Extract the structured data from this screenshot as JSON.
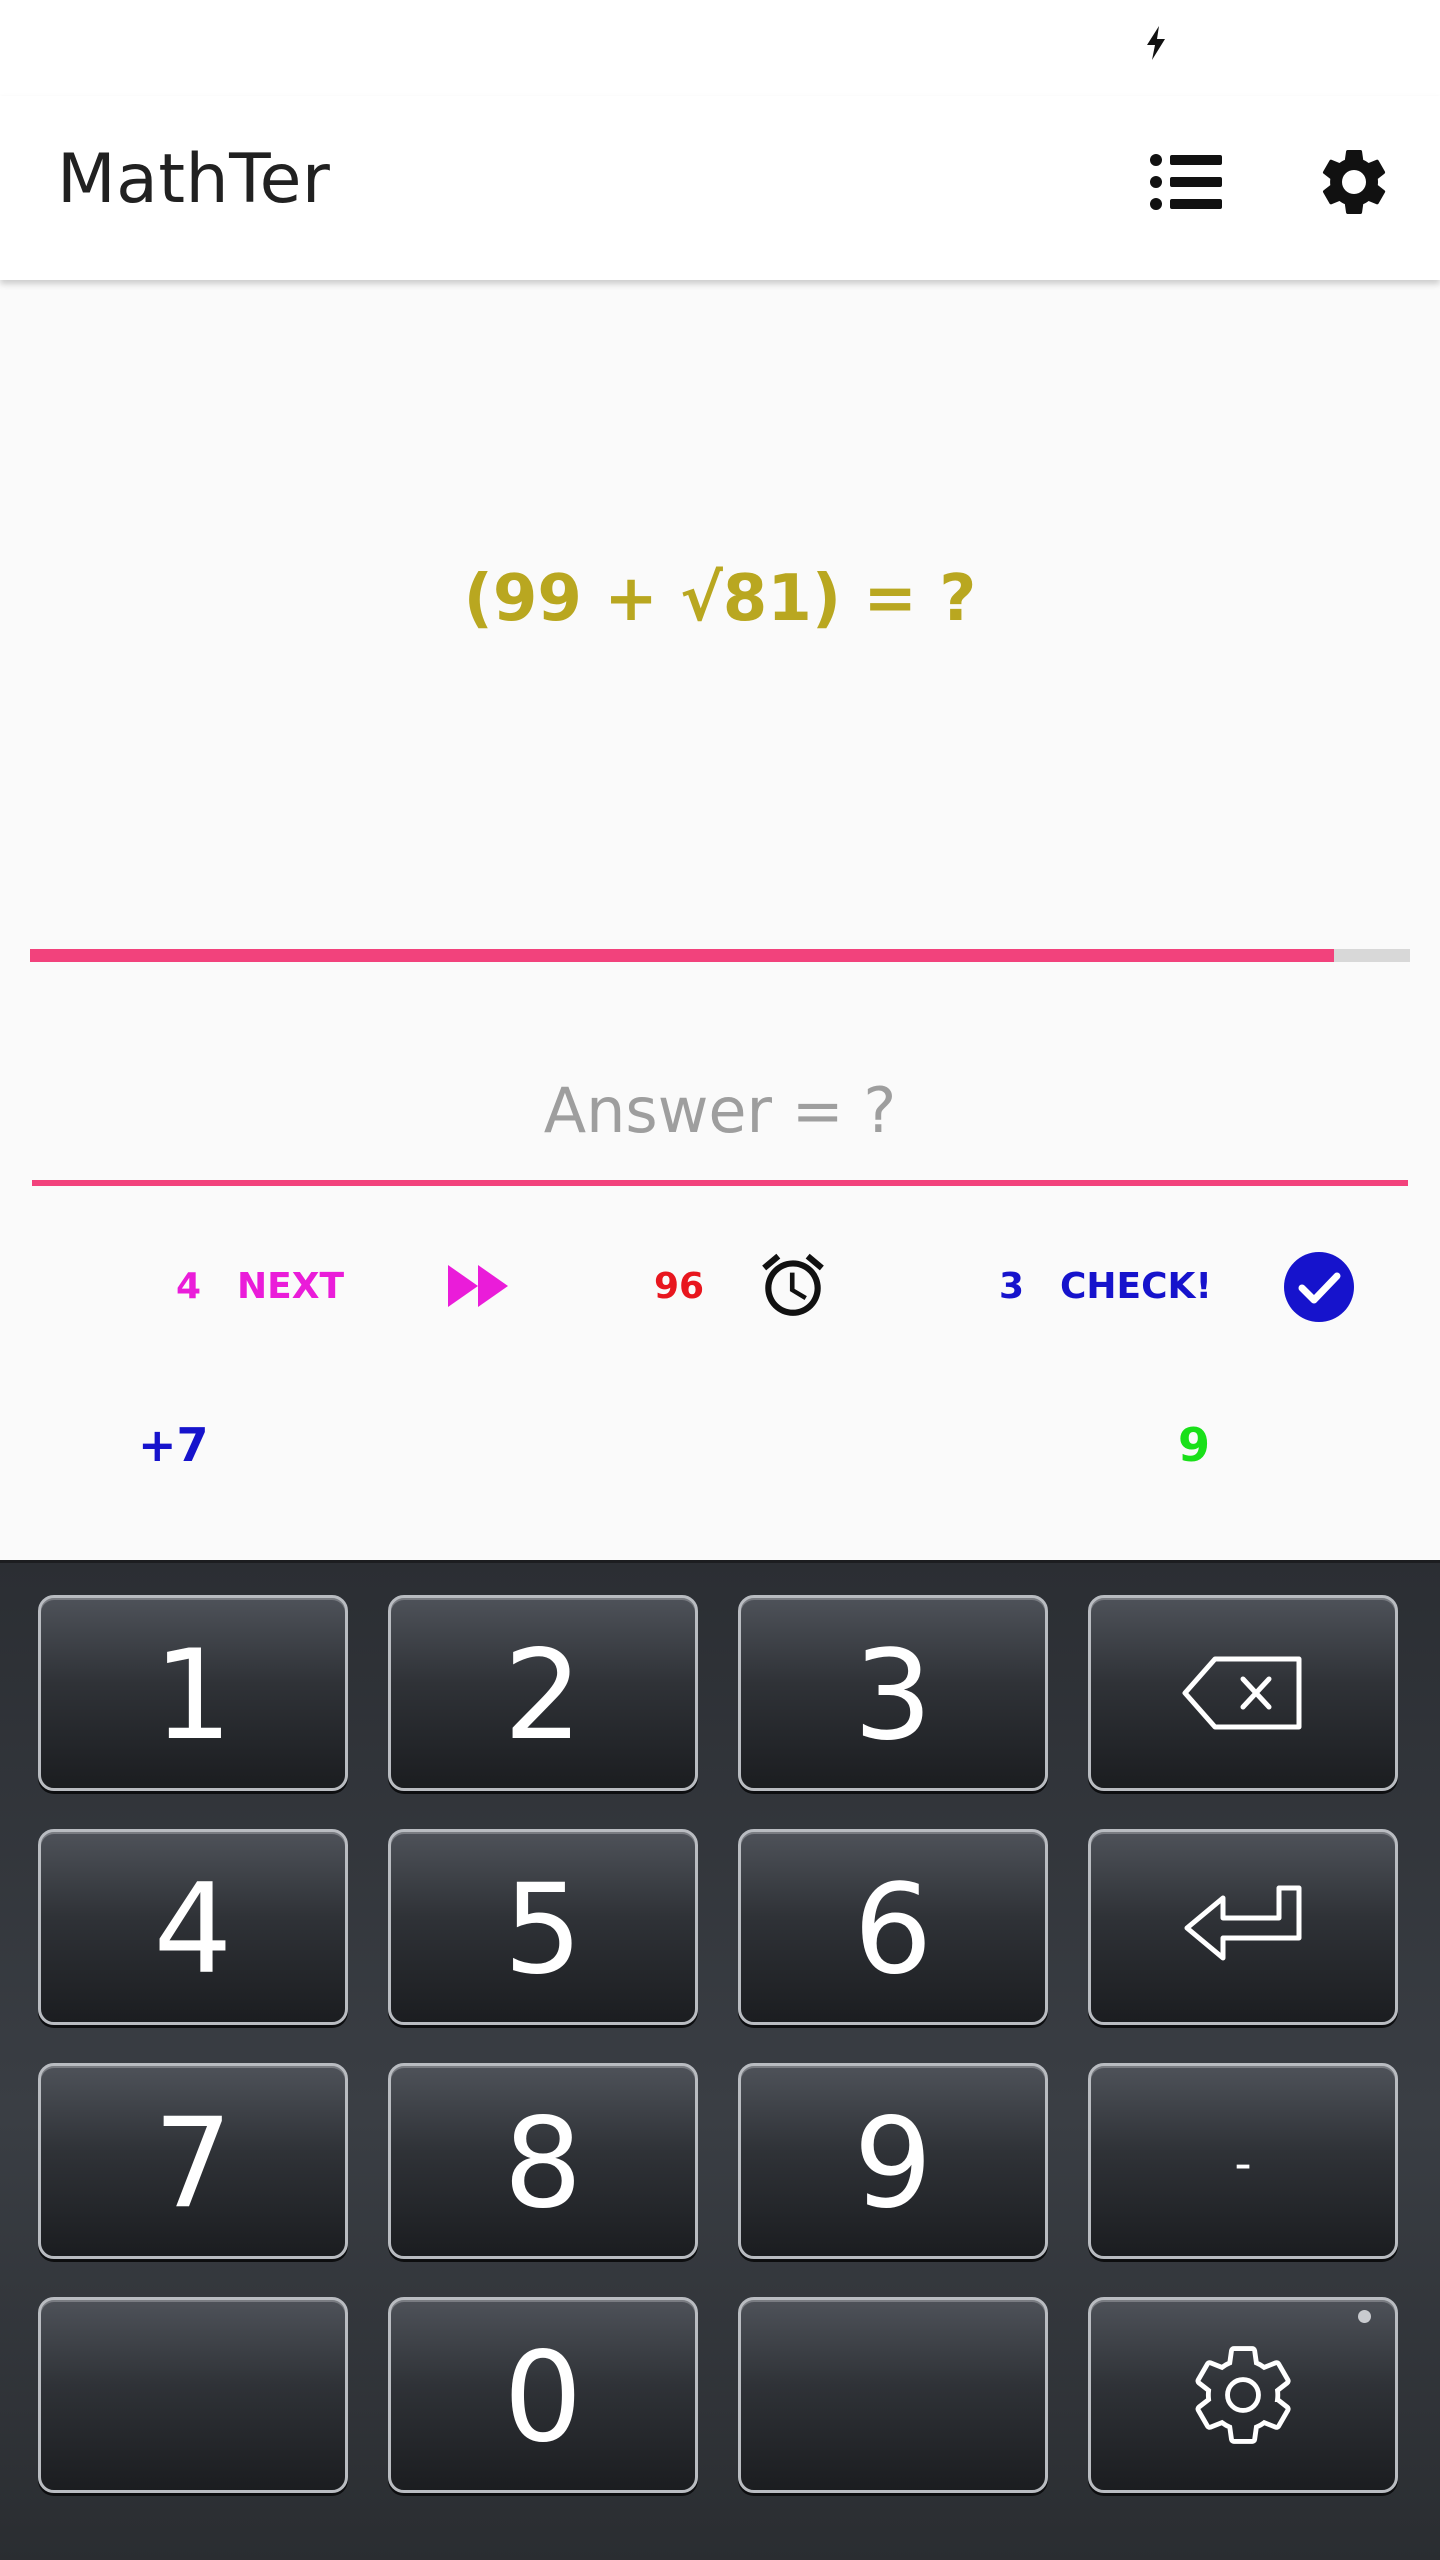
{
  "app": {
    "title": "MathTer"
  },
  "question": {
    "text": "(99 +  √81) = ?"
  },
  "progress": {
    "fraction": 0.945,
    "color": "#f2427c"
  },
  "answer": {
    "value": "",
    "placeholder": "Answer = ?"
  },
  "controls": {
    "next_count": "4",
    "next_label": "NEXT",
    "timer": "96",
    "check_count": "3",
    "check_label": "CHECK!"
  },
  "bonus": "+7",
  "score": "9",
  "keypad": {
    "keys": [
      "1",
      "2",
      "3",
      "4",
      "5",
      "6",
      "7",
      "8",
      "9",
      "-",
      "0"
    ]
  },
  "colors": {
    "next": "#ea1cd9",
    "timer": "#e8161e",
    "check": "#1613cc",
    "score": "#19e019",
    "question": "#b9a720"
  },
  "icons": [
    "charging-bolt-icon",
    "list-icon",
    "gear-icon",
    "fast-forward-icon",
    "alarm-clock-icon",
    "check-circle-icon",
    "backspace-icon",
    "enter-icon",
    "keyboard-settings-icon"
  ]
}
